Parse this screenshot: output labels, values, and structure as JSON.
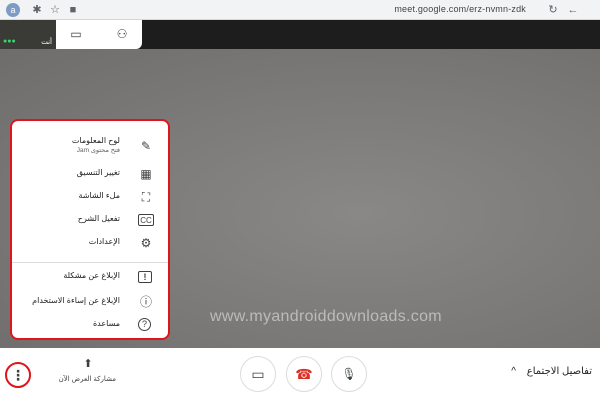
{
  "browser": {
    "profile_initial": "a",
    "url": "meet.google.com/erz-nvmn-zdk",
    "icons": [
      "puzzle-icon",
      "star-icon",
      "camera-icon",
      "reload-icon",
      "back-icon"
    ]
  },
  "self_tile": {
    "label": "أنت",
    "dots": "●●●"
  },
  "top_tabs": [
    "chat-icon",
    "people-icon"
  ],
  "menu": {
    "items": [
      {
        "label": "لوح المعلومات",
        "sub": "فتح محتوى Jam",
        "icon": "✎"
      },
      {
        "label": "تغيير التنسيق",
        "icon": "▦"
      },
      {
        "label": "ملء الشاشة",
        "icon": "⛶"
      },
      {
        "label": "تفعيل الشرح",
        "icon": "CC"
      },
      {
        "label": "الإعدادات",
        "icon": "⚙"
      },
      {
        "label": "الإبلاغ عن مشكلة",
        "icon": "!"
      },
      {
        "label": "الإبلاغ عن إساءة الاستخدام",
        "icon": "ⓘ"
      },
      {
        "label": "مساعدة",
        "icon": "?"
      }
    ]
  },
  "watermark": "www.myandroiddownloads.com",
  "bottom": {
    "more_icon": "⋮",
    "present_label": "مشاركة العرض الآن",
    "present_icon": "⬆",
    "camera_icon": "▭",
    "hangup_icon": "☎",
    "mic_icon": "🎙",
    "details_label": "تفاصيل الاجتماع",
    "details_chevron": "^"
  },
  "colors": {
    "highlight": "#e0141b",
    "hangup": "#d93025"
  }
}
